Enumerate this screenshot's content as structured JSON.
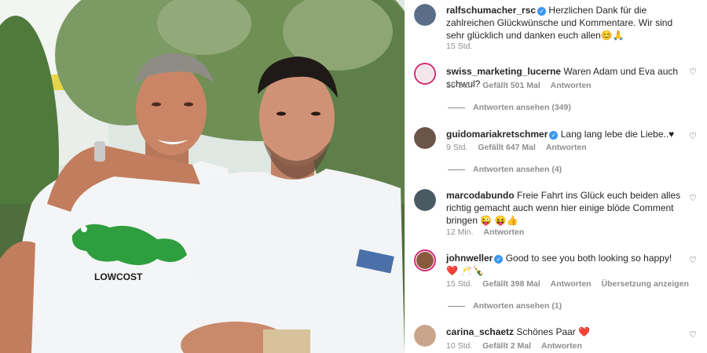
{
  "photo": {
    "shirt_text": "LOWCOST"
  },
  "comments": [
    {
      "user": "ralfschumacher_rsc",
      "verified": true,
      "text": "Herzlichen Dank für die zahlreichen Glückwünsche und Kommentare. Wir sind sehr glücklich und danken euch allen😊🙏",
      "time": "15 Std.",
      "likes": "",
      "reply": ""
    },
    {
      "user": "swiss_marketing_lucerne",
      "verified": false,
      "text": "Waren Adam und Eva auch schwul?",
      "time": "15 Std.",
      "likes": "Gefällt 501 Mal",
      "reply": "Antworten",
      "view_replies": "Antworten ansehen (349)"
    },
    {
      "user": "guidomariakretschmer",
      "verified": true,
      "text": "Lang lang lebe die Liebe..♥",
      "time": "9 Std.",
      "likes": "Gefällt 647 Mal",
      "reply": "Antworten",
      "view_replies": "Antworten ansehen (4)"
    },
    {
      "user": "marcodabundo",
      "verified": false,
      "text": "Freie Fahrt ins Glück euch beiden alles richtig gemacht auch wenn hier einige blöde Comment bringen 😜 😝👍",
      "time": "12 Min.",
      "likes": "",
      "reply": "Antworten"
    },
    {
      "user": "johnweller",
      "verified": true,
      "text": "Good to see you both looking so happy! ❤️ 🥂🍾",
      "time": "15 Std.",
      "likes": "Gefällt 398 Mal",
      "reply": "Antworten",
      "translate": "Übersetzung anzeigen",
      "view_replies": "Antworten ansehen (1)"
    },
    {
      "user": "carina_schaetz",
      "verified": false,
      "text": "Schönes Paar ❤️",
      "time": "10 Std.",
      "likes": "Gefällt 2 Mal",
      "reply": "Antworten"
    }
  ],
  "colors": {
    "accent_blue": "#3897f0",
    "text_secondary": "#8e8e8e",
    "story_ring": "#d62976"
  },
  "icons": {
    "like": "heart-outline-icon",
    "verified": "verified-badge-icon"
  }
}
